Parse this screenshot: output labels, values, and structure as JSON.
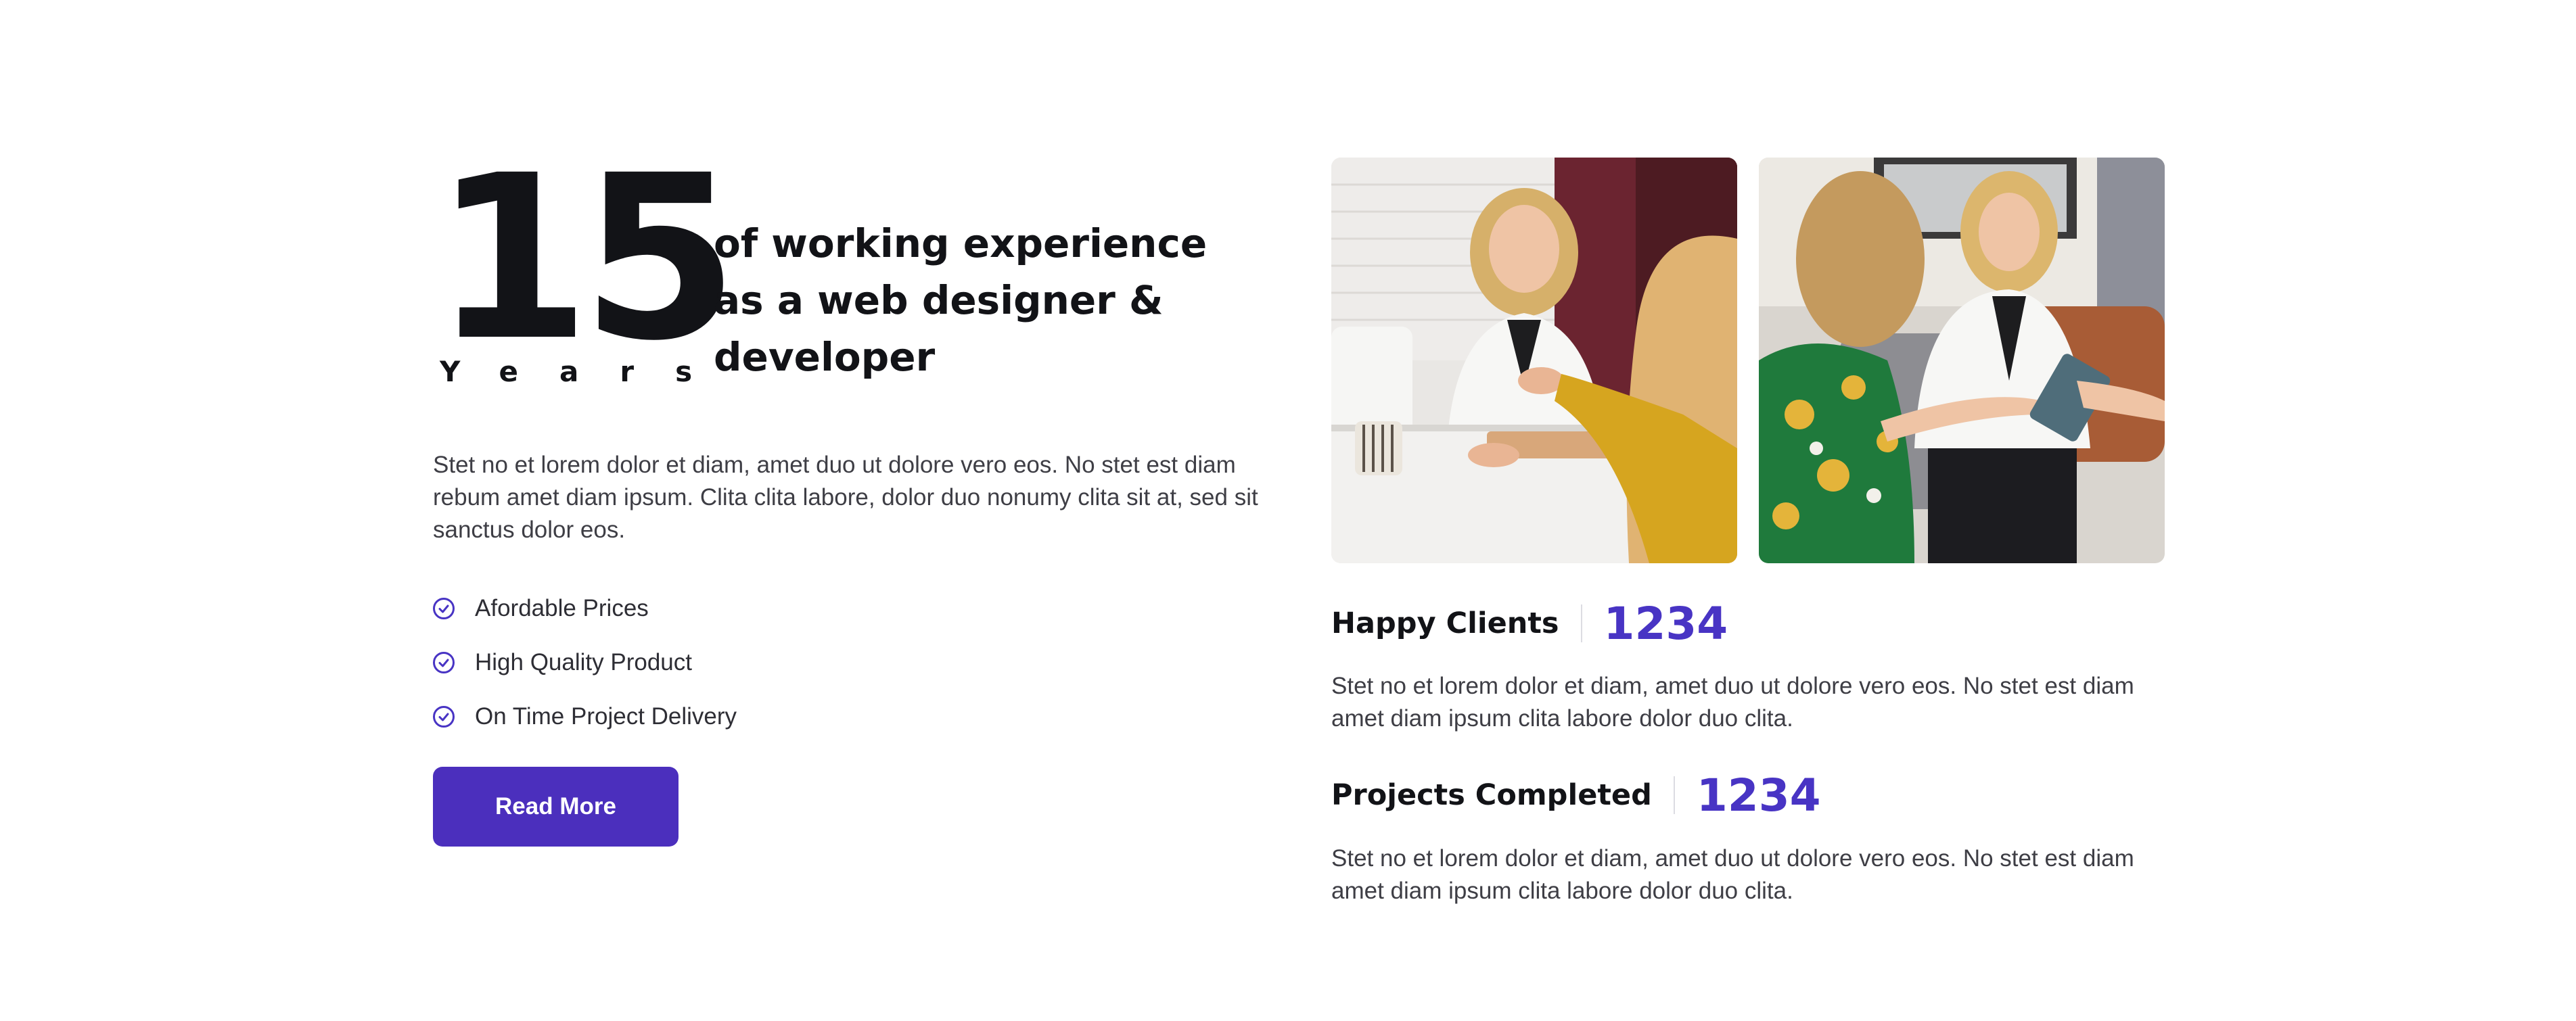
{
  "experience": {
    "years_number": "15",
    "years_label": "Years",
    "description": "of working experience as a web designer & developer"
  },
  "intro": {
    "text": "Stet no et lorem dolor et diam, amet duo ut dolore vero eos. No stet est diam rebum amet diam ipsum. Clita clita labore, dolor duo nonumy clita sit at, sed sit sanctus dolor eos."
  },
  "features": [
    {
      "label": "Afordable Prices",
      "icon": "check-circle-icon"
    },
    {
      "label": "High Quality Product",
      "icon": "check-circle-icon"
    },
    {
      "label": "On Time Project Delivery",
      "icon": "check-circle-icon"
    }
  ],
  "cta": {
    "label": "Read More"
  },
  "stats": [
    {
      "label": "Happy Clients",
      "value": "1234",
      "description": "Stet no et lorem dolor et diam, amet duo ut dolore vero eos. No stet est diam amet diam ipsum clita labore dolor duo clita."
    },
    {
      "label": "Projects Completed",
      "value": "1234",
      "description": "Stet no et lorem dolor et diam, amet duo ut dolore vero eos. No stet est diam amet diam ipsum clita labore dolor duo clita."
    }
  ],
  "colors": {
    "accent": "#4b2fbd",
    "stat_value": "#4834c4",
    "heading": "#121317",
    "body_text": "#3e3e45"
  }
}
